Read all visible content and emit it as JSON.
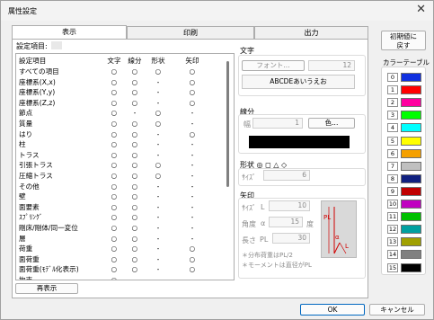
{
  "window": {
    "title": "属性設定",
    "close_glyph": "✕"
  },
  "tabs": [
    {
      "label": "表示"
    },
    {
      "label": "印刷"
    },
    {
      "label": "出力"
    }
  ],
  "settings_item_label": "設定項目:",
  "list": {
    "headers": [
      "設定項目",
      "文字",
      "線分",
      "形状",
      "矢印"
    ],
    "rows": [
      [
        "すべての項目",
        "○",
        "○",
        "○",
        "○"
      ],
      [
        "座標系(X,x)",
        "○",
        "○",
        "-",
        "○"
      ],
      [
        "座標系(Y,y)",
        "○",
        "○",
        "-",
        "○"
      ],
      [
        "座標系(Z,z)",
        "○",
        "○",
        "-",
        "○"
      ],
      [
        "節点",
        "○",
        "-",
        "○",
        "-"
      ],
      [
        "質量",
        "○",
        "○",
        "○",
        "-"
      ],
      [
        "はり",
        "○",
        "○",
        "-",
        "○"
      ],
      [
        "柱",
        "○",
        "○",
        "-",
        "-"
      ],
      [
        "トラス",
        "○",
        "○",
        "-",
        "-"
      ],
      [
        "引張トラス",
        "○",
        "○",
        "○",
        "-"
      ],
      [
        "圧縮トラス",
        "○",
        "○",
        "○",
        "-"
      ],
      [
        "その他",
        "○",
        "○",
        "-",
        "-"
      ],
      [
        "壁",
        "○",
        "○",
        "-",
        "-"
      ],
      [
        "面要素",
        "○",
        "○",
        "-",
        "-"
      ],
      [
        "ｽﾌﾟﾘﾝｸﾞ",
        "○",
        "○",
        "-",
        "-"
      ],
      [
        "剛床/剛体/同一変位",
        "○",
        "○",
        "-",
        "-"
      ],
      [
        "層",
        "○",
        "○",
        "-",
        "-"
      ],
      [
        "荷重",
        "○",
        "○",
        "-",
        "○"
      ],
      [
        "面荷重",
        "○",
        "○",
        "-",
        "○"
      ],
      [
        "面荷重(ﾓﾃﾞﾙ化表示)",
        "○",
        "○",
        "-",
        "○"
      ],
      [
        "拘束",
        "○",
        "-",
        "-",
        "-"
      ]
    ]
  },
  "redisplay_button": "再表示",
  "text_group": {
    "title": "文字",
    "font_button": "フォント...",
    "font_size": "12",
    "preview": "ABCDEあいうえお"
  },
  "line_group": {
    "title": "線分",
    "width_label": "幅",
    "width_value": "1",
    "color_button": "色..."
  },
  "shape_group": {
    "title": "形状 ◎ ◻ △ ◇",
    "size_label": "ｻｲｽﾞ",
    "size_value": "6"
  },
  "arrow_group": {
    "title": "矢印",
    "size_label": "ｻｲｽﾞ",
    "size_unit": "L",
    "size_value": "10",
    "angle_label": "角度",
    "angle_unit": "α",
    "angle_value": "15",
    "angle_suffix": "度",
    "length_label": "長さ",
    "length_unit": "PL",
    "length_value": "30",
    "note1": "＊分布荷重はPL/2",
    "note2": "＊モーメントは直径がPL",
    "diagram_pl": "PL",
    "diagram_alpha": "α",
    "diagram_l": "L"
  },
  "reset_button": "初期値に\n戻す",
  "color_table": {
    "title": "カラーテーブル",
    "entries": [
      {
        "n": "0",
        "color": "#1030e0"
      },
      {
        "n": "1",
        "color": "#ff0000"
      },
      {
        "n": "2",
        "color": "#ff00a0"
      },
      {
        "n": "3",
        "color": "#00ff00"
      },
      {
        "n": "4",
        "color": "#00ffff"
      },
      {
        "n": "5",
        "color": "#ffff00"
      },
      {
        "n": "6",
        "color": "#f5a000"
      },
      {
        "n": "7",
        "color": "#c0c0c0"
      },
      {
        "n": "8",
        "color": "#102080"
      },
      {
        "n": "9",
        "color": "#c00000"
      },
      {
        "n": "10",
        "color": "#c000c0"
      },
      {
        "n": "11",
        "color": "#00c000"
      },
      {
        "n": "12",
        "color": "#00a0a0"
      },
      {
        "n": "13",
        "color": "#a0a000"
      },
      {
        "n": "14",
        "color": "#808080"
      },
      {
        "n": "15",
        "color": "#000000"
      }
    ]
  },
  "footer": {
    "ok": "OK",
    "cancel": "キャンセル"
  }
}
